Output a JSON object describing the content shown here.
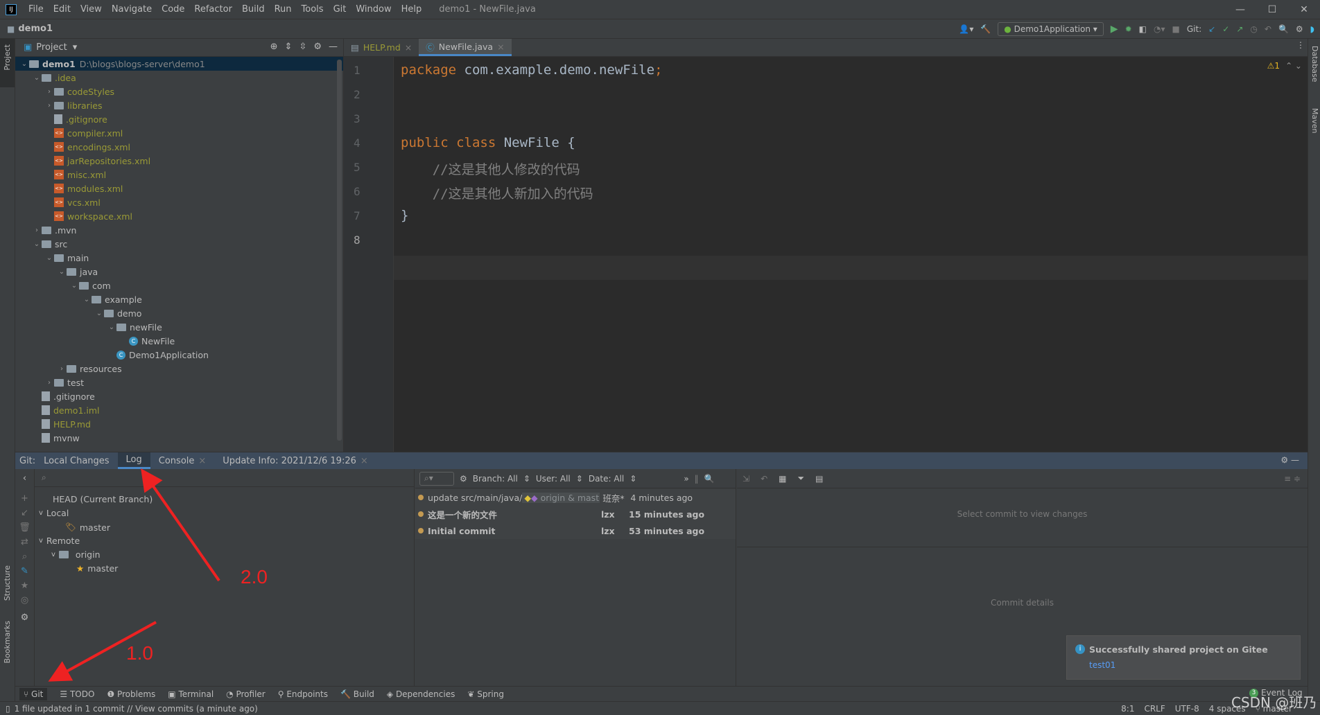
{
  "menubar": {
    "items": [
      "File",
      "Edit",
      "View",
      "Navigate",
      "Code",
      "Refactor",
      "Build",
      "Run",
      "Tools",
      "Git",
      "Window",
      "Help"
    ],
    "title": "demo1 - NewFile.java"
  },
  "navbar": {
    "project": "demo1",
    "run_config": "Demo1Application",
    "git_label": "Git:"
  },
  "left_stripe": {
    "project": "Project",
    "structure": "Structure",
    "bookmarks": "Bookmarks"
  },
  "right_stripe": {
    "database": "Database",
    "maven": "Maven"
  },
  "project_panel": {
    "title": "Project",
    "root_path": "D:\\blogs\\blogs-server\\demo1",
    "tree": [
      {
        "level": 0,
        "name": "demo1",
        "type": "module",
        "chev": "v",
        "bold": true
      },
      {
        "level": 1,
        "name": ".idea",
        "type": "folder",
        "chev": "v",
        "ignored": true
      },
      {
        "level": 2,
        "name": "codeStyles",
        "type": "folder",
        "chev": ">",
        "ignored": true
      },
      {
        "level": 2,
        "name": "libraries",
        "type": "folder",
        "chev": ">",
        "ignored": true
      },
      {
        "level": 2,
        "name": ".gitignore",
        "type": "file",
        "chev": "",
        "ignored": true
      },
      {
        "level": 2,
        "name": "compiler.xml",
        "type": "xml",
        "chev": "",
        "ignored": true
      },
      {
        "level": 2,
        "name": "encodings.xml",
        "type": "xml",
        "chev": "",
        "ignored": true
      },
      {
        "level": 2,
        "name": "jarRepositories.xml",
        "type": "xml",
        "chev": "",
        "ignored": true
      },
      {
        "level": 2,
        "name": "misc.xml",
        "type": "xml",
        "chev": "",
        "ignored": true
      },
      {
        "level": 2,
        "name": "modules.xml",
        "type": "xml",
        "chev": "",
        "ignored": true
      },
      {
        "level": 2,
        "name": "vcs.xml",
        "type": "xml",
        "chev": "",
        "ignored": true
      },
      {
        "level": 2,
        "name": "workspace.xml",
        "type": "xml",
        "chev": "",
        "ignored": true
      },
      {
        "level": 1,
        "name": ".mvn",
        "type": "folder",
        "chev": ">"
      },
      {
        "level": 1,
        "name": "src",
        "type": "folder",
        "chev": "v"
      },
      {
        "level": 2,
        "name": "main",
        "type": "folder",
        "chev": "v"
      },
      {
        "level": 3,
        "name": "java",
        "type": "folder",
        "chev": "v"
      },
      {
        "level": 4,
        "name": "com",
        "type": "folder",
        "chev": "v"
      },
      {
        "level": 5,
        "name": "example",
        "type": "folder",
        "chev": "v"
      },
      {
        "level": 6,
        "name": "demo",
        "type": "folder",
        "chev": "v"
      },
      {
        "level": 7,
        "name": "newFile",
        "type": "folder",
        "chev": "v"
      },
      {
        "level": 8,
        "name": "NewFile",
        "type": "class",
        "chev": ""
      },
      {
        "level": 7,
        "name": "Demo1Application",
        "type": "class",
        "chev": ""
      },
      {
        "level": 3,
        "name": "resources",
        "type": "folder",
        "chev": ">"
      },
      {
        "level": 2,
        "name": "test",
        "type": "folder",
        "chev": ">"
      },
      {
        "level": 1,
        "name": ".gitignore",
        "type": "file",
        "chev": ""
      },
      {
        "level": 1,
        "name": "demo1.iml",
        "type": "file",
        "chev": "",
        "ignored": true
      },
      {
        "level": 1,
        "name": "HELP.md",
        "type": "file",
        "chev": "",
        "ignored": true
      },
      {
        "level": 1,
        "name": "mvnw",
        "type": "file",
        "chev": ""
      }
    ]
  },
  "editor": {
    "tabs": [
      {
        "label": "HELP.md",
        "active": false
      },
      {
        "label": "NewFile.java",
        "active": true
      }
    ],
    "warnings": "⚠1",
    "lines": [
      [
        {
          "t": "package ",
          "c": "kw"
        },
        {
          "t": "com.example.demo.newFile",
          "c": ""
        },
        {
          "t": ";",
          "c": "kw"
        }
      ],
      [],
      [],
      [
        {
          "t": "public class ",
          "c": "kw"
        },
        {
          "t": "NewFile {",
          "c": ""
        }
      ],
      [
        {
          "t": "    //这是其他人修改的代码",
          "c": "cm"
        }
      ],
      [
        {
          "t": "    //这是其他人新加入的代码",
          "c": "cm"
        }
      ],
      [
        {
          "t": "}",
          "c": ""
        }
      ],
      []
    ]
  },
  "git_panel": {
    "prefix": "Git:",
    "tabs": [
      {
        "label": "Local Changes"
      },
      {
        "label": "Log",
        "active": true
      },
      {
        "label": "Console",
        "closable": true
      },
      {
        "label": "Update Info: 2021/12/6 19:26",
        "closable": true
      }
    ],
    "branches": {
      "head": "HEAD (Current Branch)",
      "local": "Local",
      "local_master": "master",
      "remote": "Remote",
      "origin": "origin",
      "remote_master": "master"
    },
    "filters": {
      "branch": "Branch: All",
      "user": "User: All",
      "date": "Date: All"
    },
    "commits": [
      {
        "message": "update src/main/java/",
        "refs": "origin & master",
        "author": "班奈*",
        "time": "4 minutes ago",
        "bold": false
      },
      {
        "message": "这是一个新的文件",
        "refs": "",
        "author": "lzx",
        "time": "15 minutes ago",
        "bold": true
      },
      {
        "message": "Initial commit",
        "refs": "",
        "author": "lzx",
        "time": "53 minutes ago",
        "bold": true
      }
    ],
    "select_hint": "Select commit to view changes",
    "details_hint": "Commit details"
  },
  "tool_buttons": [
    "Git",
    "TODO",
    "Problems",
    "Terminal",
    "Profiler",
    "Endpoints",
    "Build",
    "Dependencies",
    "Spring"
  ],
  "notification": {
    "title": "Successfully shared project on Gitee",
    "link": "test01",
    "event_log": "Event Log",
    "event_count": "3"
  },
  "status_bar": {
    "message": "1 file updated in 1 commit // View commits (a minute ago)",
    "position": "8:1",
    "line_sep": "CRLF",
    "encoding": "UTF-8",
    "indent": "4 spaces",
    "branch": "master"
  },
  "annotations": {
    "label1": "1.0",
    "label2": "2.0",
    "color": "#ee2222"
  },
  "watermark": "CSDN @班乃"
}
